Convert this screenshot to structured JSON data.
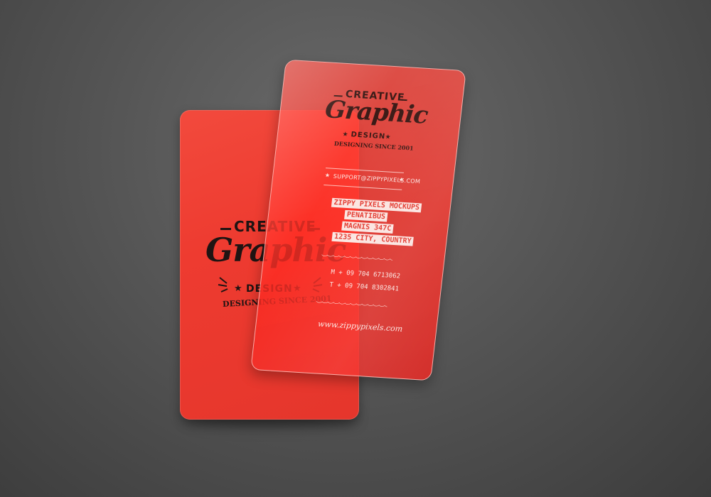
{
  "scene": {
    "background_color": "#575757",
    "card_color": "#ee3b30"
  },
  "back_card": {
    "logo": {
      "line1": "CREATIVE",
      "line2": "Graphic",
      "line3": "DESIGN",
      "line4": "DESIGNING SINCE 2001"
    }
  },
  "front_card": {
    "logo": {
      "line1": "CREATIVE",
      "line2": "Graphic",
      "line3": "DESIGN",
      "line4": "DESIGNING SINCE 2001"
    },
    "email": "SUPPORT@ZIPPYPIXELS.COM",
    "address": [
      "ZIPPY PIXELS MOCKUPS",
      "PENATIBUS",
      "MAGNIS 347C",
      "1235 CITY, COUNTRY"
    ],
    "mobile": "M + 09 704 6713062",
    "telephone": "T + 09 704 8302841",
    "website": "www.zippypixels.com"
  }
}
